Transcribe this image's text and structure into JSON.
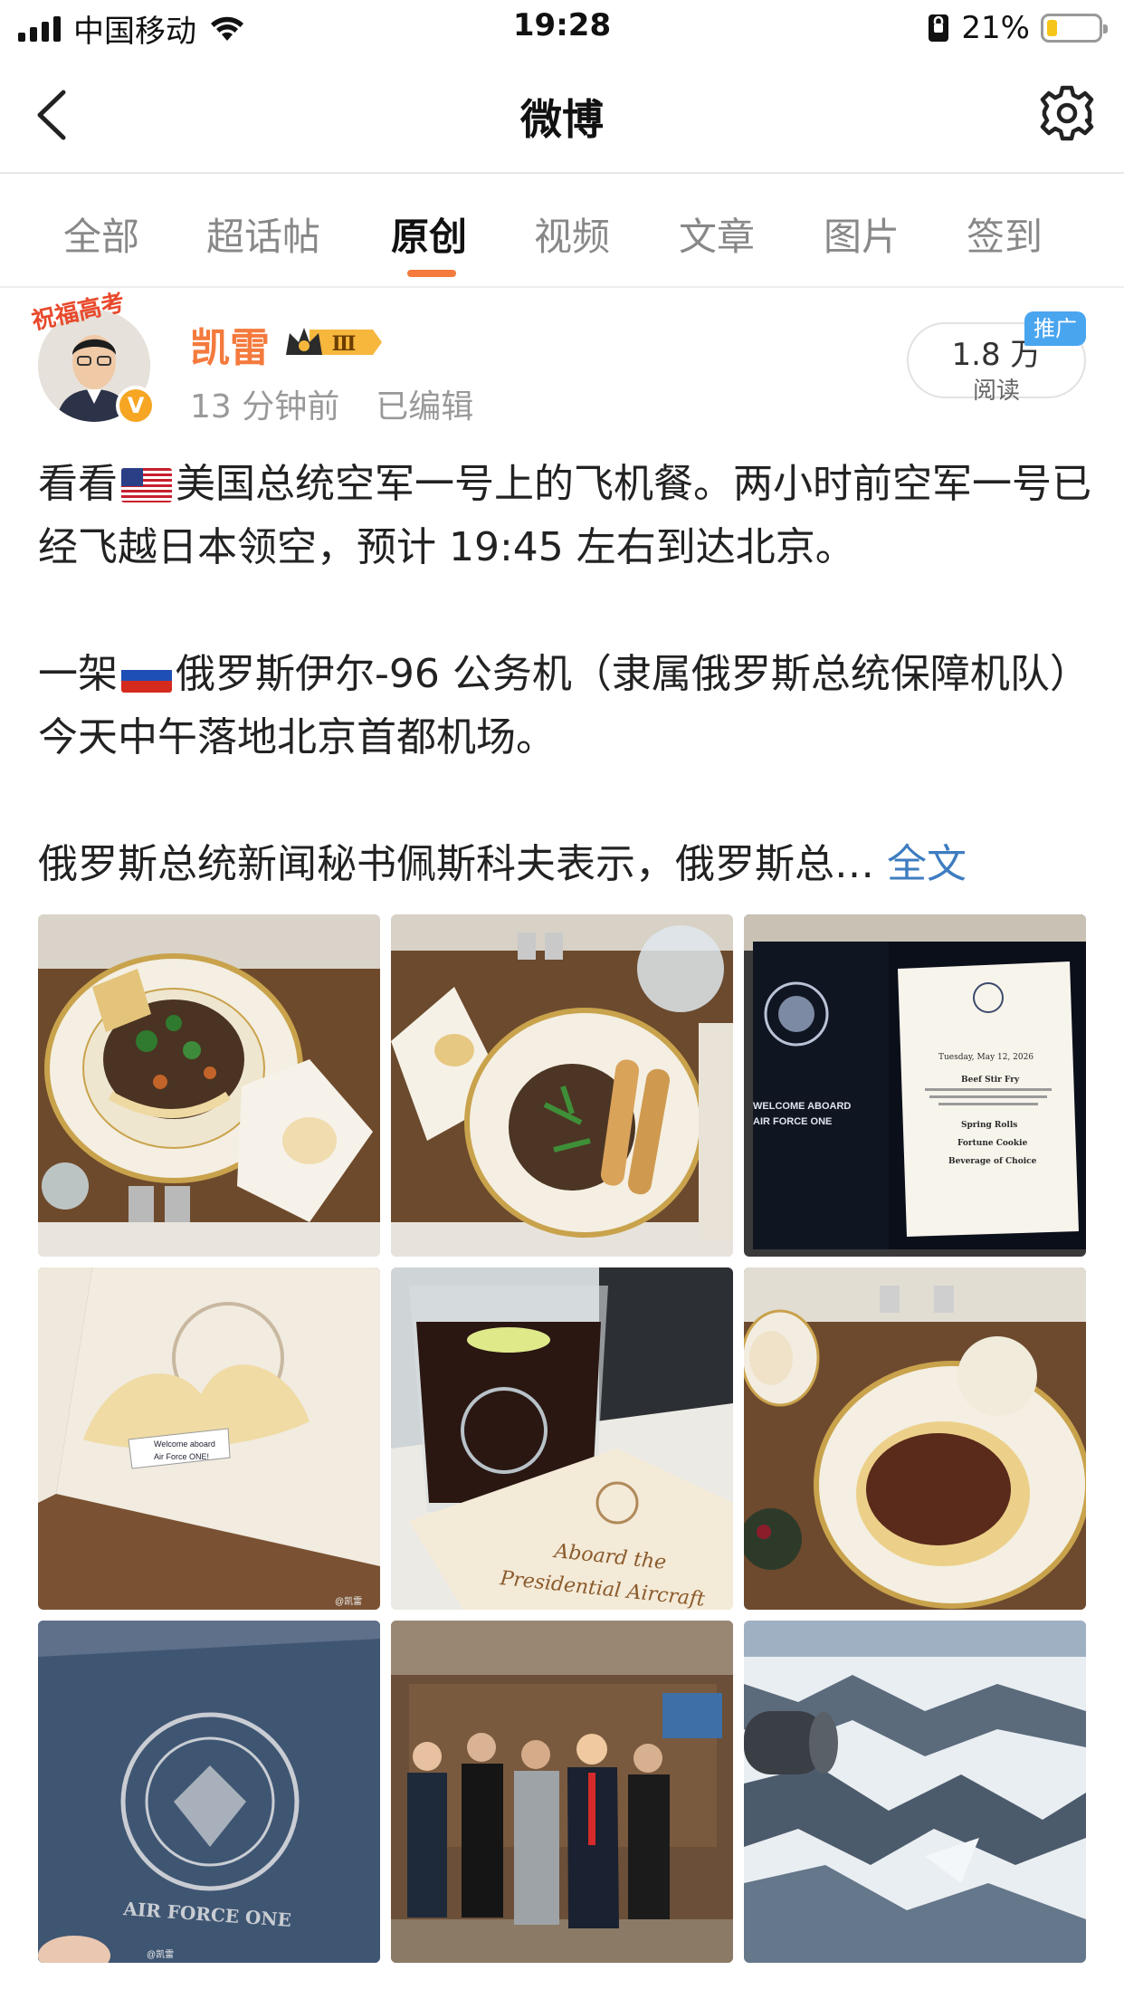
{
  "status_bar": {
    "carrier": "中国移动",
    "time": "19:28",
    "battery": "21%",
    "battery_level": 0.21
  },
  "nav": {
    "title": "微博",
    "back_icon": "chevron-left-icon",
    "settings_icon": "gear-icon"
  },
  "tabs": [
    {
      "label": "全部",
      "active": false
    },
    {
      "label": "超话帖",
      "active": false
    },
    {
      "label": "原创",
      "active": true
    },
    {
      "label": "视频",
      "active": false
    },
    {
      "label": "文章",
      "active": false
    },
    {
      "label": "图片",
      "active": false
    },
    {
      "label": "签到",
      "active": false
    }
  ],
  "post": {
    "avatar_ribbon": "祝福高考",
    "username": "凯雷",
    "vip_level": "Ⅲ",
    "time": "13 分钟前",
    "edited": "已编辑",
    "reads_count": "1.8 万",
    "reads_label": "阅读",
    "promo": "推广",
    "paragraphs": {
      "p1_prefix": "看看",
      "p1_rest": "美国总统空军一号上的飞机餐。两小时前空军一号已经飞越日本领空，预计 19:45 左右到达北京。",
      "p2_prefix": "一架",
      "p2_rest": "俄罗斯伊尔-96 公务机（隶属俄罗斯总统保障机队）今天中午落地北京首都机场。",
      "p3": "俄罗斯总统新闻秘书佩斯科夫表示，俄罗斯总… ",
      "full_text_link": "全文"
    }
  },
  "images": {
    "menu_welcome": "WELCOME ABOARD",
    "menu_af1": "AIR FORCE ONE",
    "menu_date": "Tuesday, May 12, 2026",
    "menu_item1": "Beef Stir Fry",
    "menu_item2": "Spring Rolls",
    "menu_item3": "Fortune Cookie",
    "menu_item4": "Beverage of Choice",
    "fortune_line1": "Welcome aboard",
    "fortune_line2": "Air Force ONE!",
    "napkin_line1": "Aboard the",
    "napkin_line2": "Presidential Aircraft",
    "bag_text": "AIR FORCE ONE",
    "watermark": "@凯雷"
  },
  "colors": {
    "accent": "#f47a3d",
    "link": "#3e7cc0",
    "promo": "#4aa5ef"
  }
}
